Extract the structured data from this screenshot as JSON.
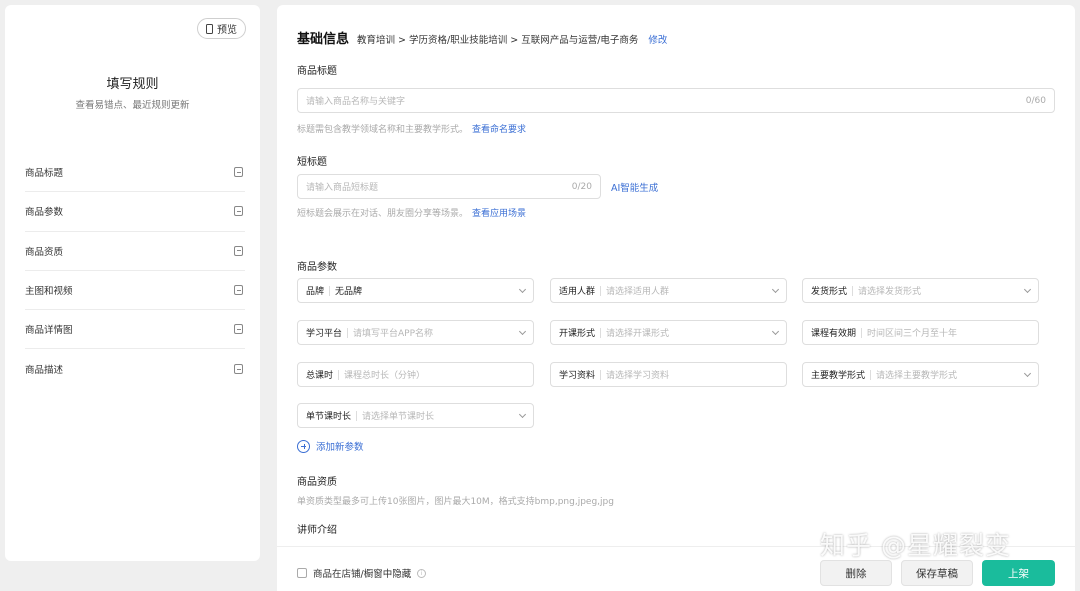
{
  "left_panel": {
    "preview_label": "预览",
    "rules_title": "填写规则",
    "rules_subtitle": "查看易错点、最近规则更新",
    "nav_items": [
      {
        "label": "商品标题"
      },
      {
        "label": "商品参数"
      },
      {
        "label": "商品资质"
      },
      {
        "label": "主图和视频"
      },
      {
        "label": "商品详情图"
      },
      {
        "label": "商品描述"
      }
    ]
  },
  "main": {
    "section_title": "基础信息",
    "breadcrumb": "教育培训 > 学历资格/职业技能培训 > 互联网产品与运营/电子商务",
    "edit_label": "修改",
    "title_field": {
      "label": "商品标题",
      "placeholder": "请输入商品名称与关键字",
      "counter": "0/60",
      "hint": "标题需包含教学领域名称和主要教学形式。",
      "hint_link": "查看命名要求"
    },
    "short_title_field": {
      "label": "短标题",
      "placeholder": "请输入商品短标题",
      "counter": "0/20",
      "ai_label": "AI智能生成",
      "hint": "短标题会展示在对话、朋友圈分享等场景。",
      "hint_link": "查看应用场景"
    },
    "params": {
      "label": "商品参数",
      "fields": [
        {
          "label": "品牌",
          "value": "无品牌",
          "placeholder": "",
          "dropdown": true
        },
        {
          "label": "适用人群",
          "value": "",
          "placeholder": "请选择适用人群",
          "dropdown": true
        },
        {
          "label": "发货形式",
          "value": "",
          "placeholder": "请选择发货形式",
          "dropdown": true
        },
        {
          "label": "学习平台",
          "value": "",
          "placeholder": "请填写平台APP名称",
          "dropdown": true
        },
        {
          "label": "开课形式",
          "value": "",
          "placeholder": "请选择开课形式",
          "dropdown": true
        },
        {
          "label": "课程有效期",
          "value": "",
          "placeholder": "时间区间三个月至十年",
          "dropdown": false
        },
        {
          "label": "总课时",
          "value": "",
          "placeholder": "课程总时长（分钟）",
          "dropdown": false
        },
        {
          "label": "学习资料",
          "value": "",
          "placeholder": "请选择学习资料",
          "dropdown": false
        },
        {
          "label": "主要教学形式",
          "value": "",
          "placeholder": "请选择主要教学形式",
          "dropdown": true
        },
        {
          "label": "单节课时长",
          "value": "",
          "placeholder": "请选择单节课时长",
          "dropdown": true
        }
      ],
      "add_label": "添加新参数"
    },
    "qualification": {
      "label": "商品资质",
      "hint": "单资质类型最多可上传10张图片，图片最大10M，格式支持bmp,png,jpeg,jpg",
      "teacher_label": "讲师介绍"
    }
  },
  "bottom_bar": {
    "hide_label": "商品在店铺/橱窗中隐藏",
    "delete_label": "删除",
    "draft_label": "保存草稿",
    "publish_label": "上架",
    "publish_color": "#1abc9c"
  },
  "watermark": "知乎 @星耀裂变"
}
